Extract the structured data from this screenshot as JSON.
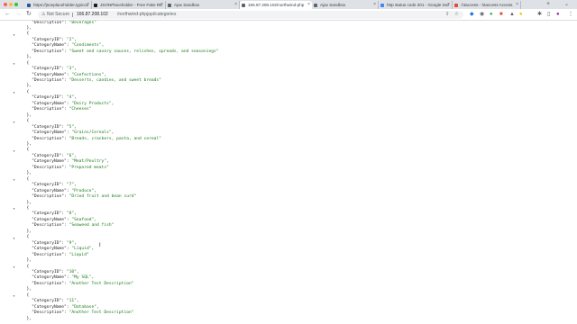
{
  "tabs": [
    {
      "label": "https://jsonplaceholder.typicode.com",
      "active": false,
      "color": "#2b579a",
      "width": 74
    },
    {
      "label": "JSONPlaceholder - Free Fake REST API",
      "active": false,
      "color": "#1a1a1a",
      "width": 82
    },
    {
      "label": "Ajax Sandbox",
      "active": false,
      "color": "#5f6368",
      "width": 82
    },
    {
      "label": "166.87.208.102/northwind-php",
      "active": true,
      "color": "#5f6368",
      "width": 80
    },
    {
      "label": "Ajax Sandbox",
      "active": false,
      "color": "#5f6368",
      "width": 74
    },
    {
      "label": "http status code 201 - Google Search",
      "active": false,
      "color": "#4285f4",
      "width": 82
    },
    {
      "label": ".htaccess - htaccess Access",
      "active": false,
      "color": "#e8453c",
      "width": 76
    }
  ],
  "toolbar": {
    "security_label": "Not Secure",
    "url_host": "166.87.208.102",
    "url_path": "/northwind-phpjapi/categories"
  },
  "records": [
    {
      "CategoryID": "2",
      "CategoryName": "Condiments",
      "Description": "Sweet and savory sauces, relishes, spreads, and seasonings"
    },
    {
      "CategoryID": "3",
      "CategoryName": "Confections",
      "Description": "Desserts, candies, and sweet breads"
    },
    {
      "CategoryID": "4",
      "CategoryName": "Dairy Products",
      "Description": "Cheeses"
    },
    {
      "CategoryID": "5",
      "CategoryName": "Grains/Cereals",
      "Description": "Breads, crackers, pasta, and cereal"
    },
    {
      "CategoryID": "6",
      "CategoryName": "Meat/Poultry",
      "Description": "Prepared meats"
    },
    {
      "CategoryID": "7",
      "CategoryName": "Produce",
      "Description": "Dried fruit and bean curd"
    },
    {
      "CategoryID": "8",
      "CategoryName": "Seafood",
      "Description": "Seaweed and fish"
    },
    {
      "CategoryID": "9",
      "CategoryName": "Liquid",
      "Description": "Liquid"
    },
    {
      "CategoryID": "10",
      "CategoryName": "My SQL",
      "Description": "Another Test Description"
    },
    {
      "CategoryID": "11",
      "CategoryName": "Database",
      "Description": "Another Test Description"
    }
  ],
  "first_description": "Beverages"
}
